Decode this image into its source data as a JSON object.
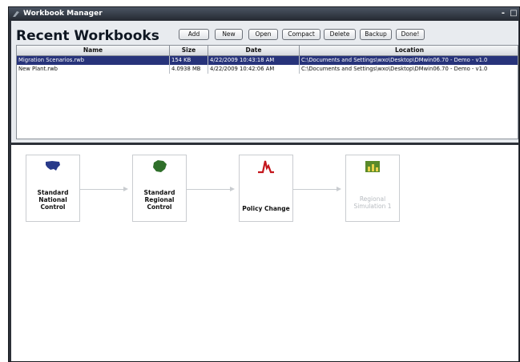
{
  "window": {
    "title": "Workbook Manager",
    "minimize_glyph": "-",
    "maximize_glyph": "□"
  },
  "recent": {
    "heading": "Recent Workbooks",
    "toolbar": {
      "add_label": "Add",
      "new_label": "New",
      "open_label": "Open",
      "compact_label": "Compact",
      "delete_label": "Delete",
      "backup_label": "Backup",
      "done_label": "Done!"
    },
    "columns": [
      "Name",
      "Size",
      "Date",
      "Location"
    ],
    "rows": [
      {
        "name": "Migration Scenarios.rwb",
        "size": "154 KB",
        "date": "4/22/2009 10:43:18 AM",
        "location": "C:\\Documents and Settings\\wxo\\Desktop\\DMwin06.70 - Demo - v1.0",
        "selected": true
      },
      {
        "name": "New Plant.rwb",
        "size": "4.0938 MB",
        "date": "4/22/2009 10:42:06 AM",
        "location": "C:\\Documents and Settings\\wxo\\Desktop\\DMwin06.70 - Demo - v1.0",
        "selected": false
      }
    ]
  },
  "flow": {
    "nodes": [
      {
        "label": "Standard\nNational\nControl",
        "icon": "us-map-icon",
        "color": "#283a8a",
        "enabled": true
      },
      {
        "label": "Standard\nRegional\nControl",
        "icon": "region-map-icon",
        "color": "#2f6f2a",
        "enabled": true
      },
      {
        "label": "Policy Change",
        "icon": "policy-spike-icon",
        "color": "#c4161c",
        "enabled": true
      },
      {
        "label": "Regional\nSimulation 1",
        "icon": "simulation-chart-icon",
        "color": "#5a8a2a",
        "enabled": false
      }
    ]
  }
}
